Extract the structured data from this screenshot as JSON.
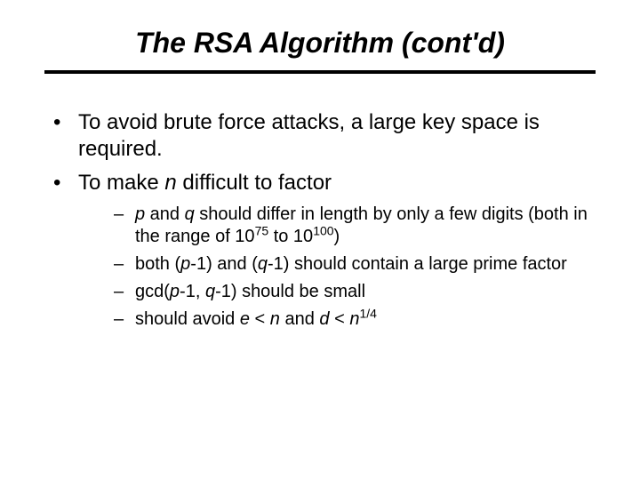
{
  "title": "The RSA Algorithm (cont'd)",
  "bullets": [
    {
      "text": "To avoid brute force attacks, a large key space is required."
    },
    {
      "parts": {
        "pre": "To make ",
        "var": "n",
        "post": " difficult to factor"
      },
      "sub": [
        {
          "parts": {
            "var1": "p",
            "mid1": " and ",
            "var2": "q",
            "mid2": " should differ in length by only a few digits (both in the range of 10",
            "sup1": "75",
            "mid3": " to 10",
            "sup2": "100",
            "end": ")"
          }
        },
        {
          "parts": {
            "pre": "both (",
            "var1": "p",
            "mid1": "-1) and (",
            "var2": "q",
            "end": "-1) should contain a large prime factor"
          }
        },
        {
          "parts": {
            "pre": "gcd(",
            "var1": "p",
            "mid1": "-1, ",
            "var2": "q",
            "end": "-1) should be small"
          }
        },
        {
          "parts": {
            "pre": "should avoid ",
            "var1": "e",
            "mid1": " < ",
            "var2": "n",
            "mid2": " and ",
            "var3": "d",
            "mid3": " < ",
            "var4": "n",
            "sup": "1/4"
          }
        }
      ]
    }
  ]
}
